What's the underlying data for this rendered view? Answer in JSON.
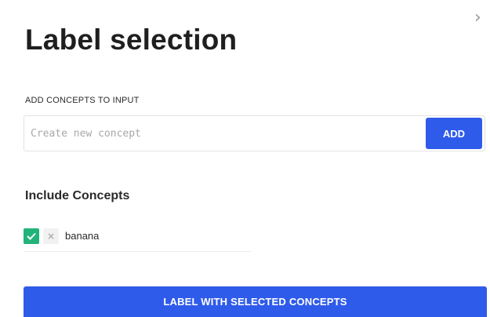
{
  "dialog": {
    "title": "Label selection",
    "close_icon": "chevron-right-icon"
  },
  "add_concepts": {
    "label": "ADD CONCEPTS TO INPUT",
    "placeholder": "Create new concept",
    "value": "",
    "add_button": "ADD"
  },
  "include": {
    "heading": "Include Concepts",
    "concepts": [
      {
        "name": "banana",
        "checked": true,
        "remove_icon": "close-icon"
      }
    ]
  },
  "footer": {
    "label_button": "LABEL WITH SELECTED CONCEPTS"
  },
  "colors": {
    "primary": "#2f5bea",
    "checkbox": "#21b37a"
  }
}
